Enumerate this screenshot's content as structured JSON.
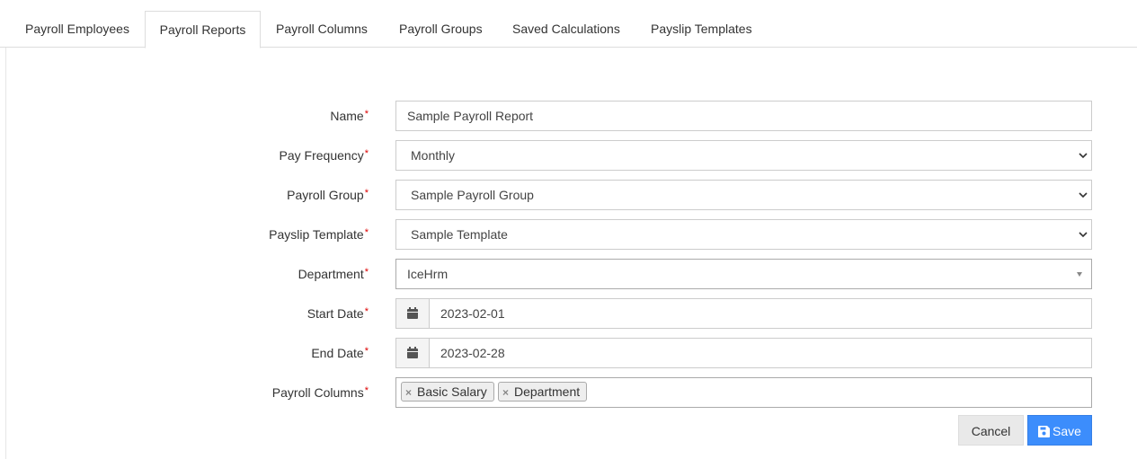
{
  "tabs": [
    {
      "label": "Payroll Employees"
    },
    {
      "label": "Payroll Reports"
    },
    {
      "label": "Payroll Columns"
    },
    {
      "label": "Payroll Groups"
    },
    {
      "label": "Saved Calculations"
    },
    {
      "label": "Payslip Templates"
    }
  ],
  "active_tab": "Payroll Reports",
  "form": {
    "required_marker": "*",
    "name": {
      "label": "Name",
      "value": "Sample Payroll Report"
    },
    "pay_frequency": {
      "label": "Pay Frequency",
      "value": "Monthly"
    },
    "payroll_group": {
      "label": "Payroll Group",
      "value": "Sample Payroll Group"
    },
    "payslip_template": {
      "label": "Payslip Template",
      "value": "Sample Template"
    },
    "department": {
      "label": "Department",
      "value": "IceHrm"
    },
    "start_date": {
      "label": "Start Date",
      "value": "2023-02-01"
    },
    "end_date": {
      "label": "End Date",
      "value": "2023-02-28"
    },
    "payroll_columns": {
      "label": "Payroll Columns",
      "chips": [
        "Basic Salary",
        "Department"
      ],
      "remove_glyph": "×"
    }
  },
  "buttons": {
    "cancel": "Cancel",
    "save": "Save"
  },
  "colors": {
    "accent": "#3c8dfc",
    "required": "#dd0000"
  },
  "icons": {
    "date_addon": "calendar-icon",
    "save": "floppy-disk-icon",
    "select": "chevron-down-icon",
    "chip_remove": "close-icon"
  }
}
